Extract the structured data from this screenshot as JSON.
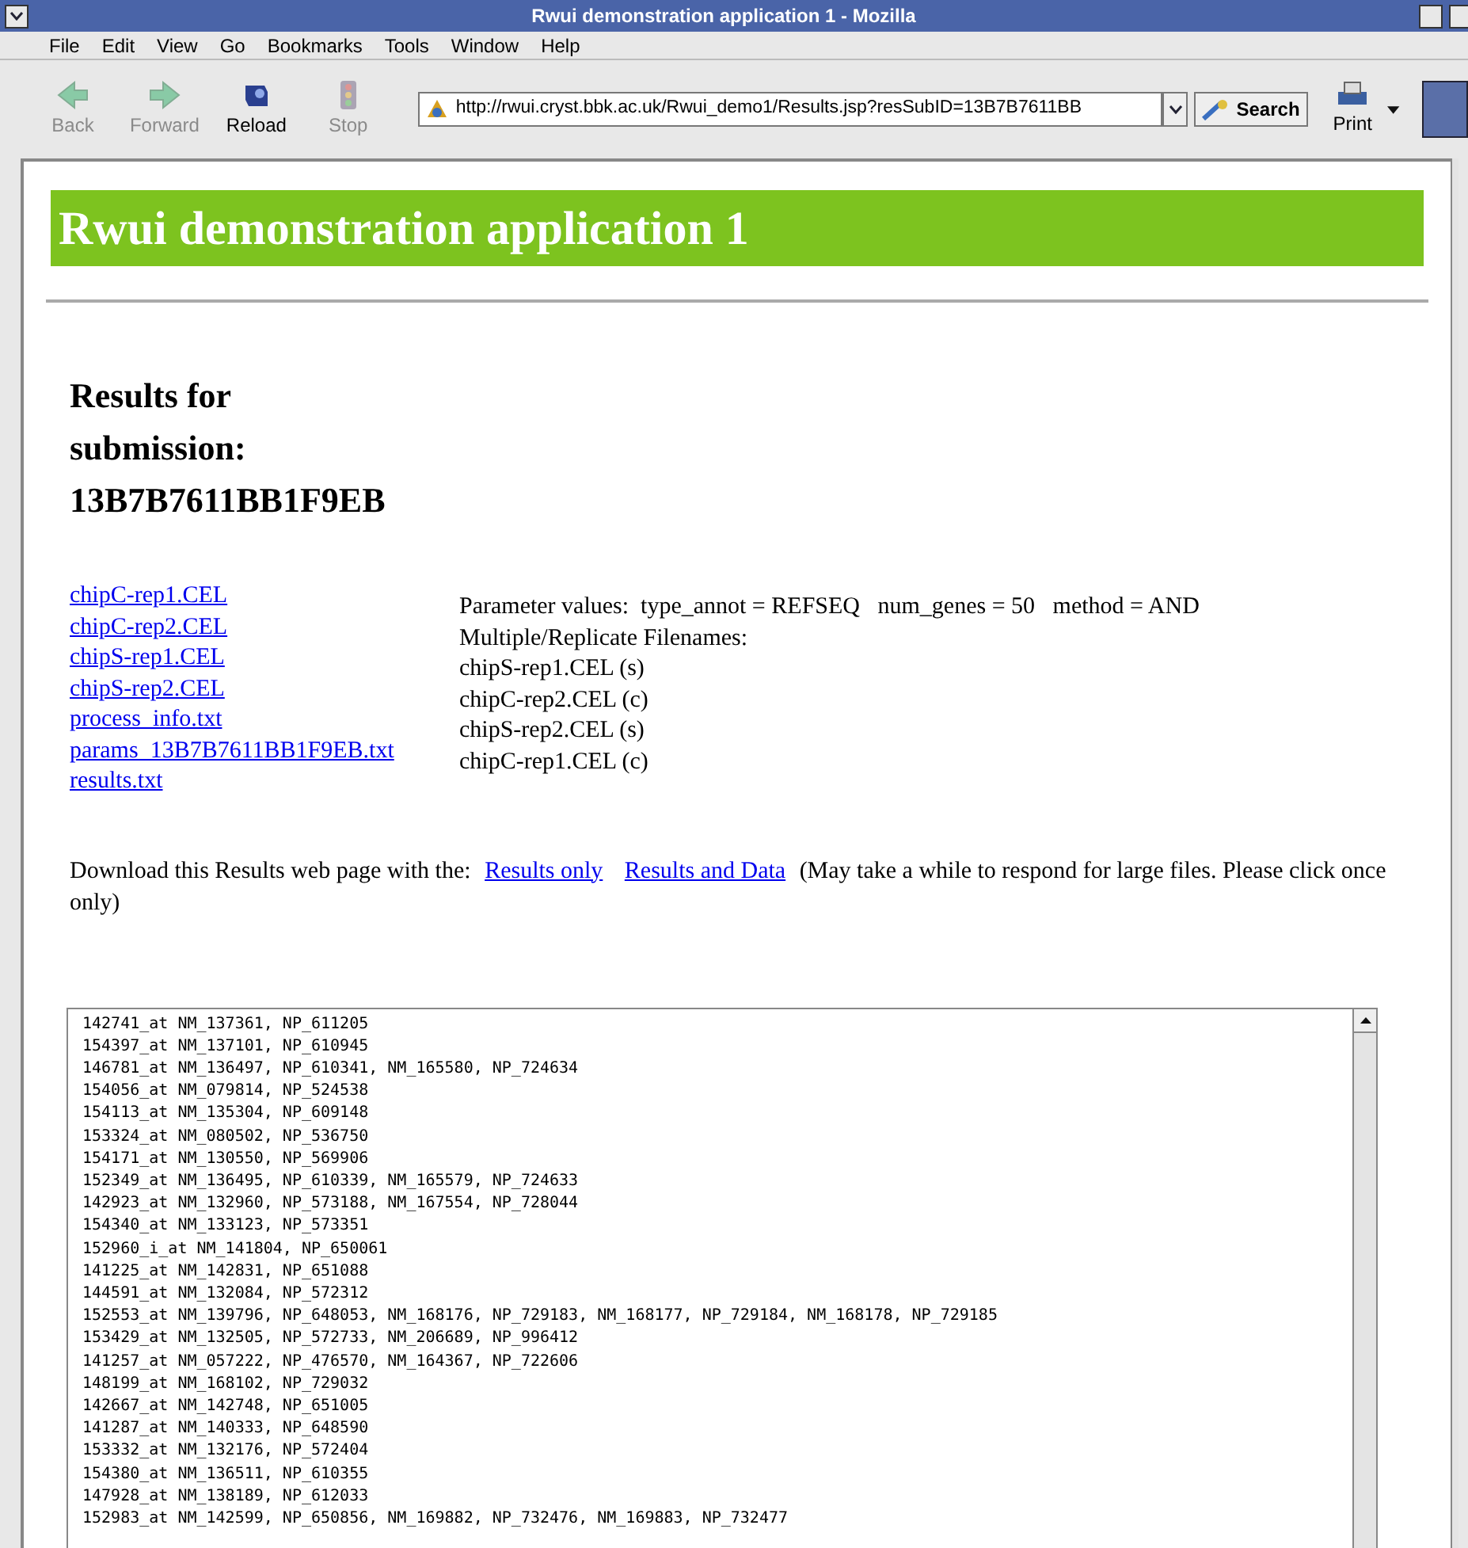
{
  "window": {
    "title": "Rwui demonstration application 1 - Mozilla"
  },
  "menu": [
    "File",
    "Edit",
    "View",
    "Go",
    "Bookmarks",
    "Tools",
    "Window",
    "Help"
  ],
  "toolbar": {
    "buttons": [
      {
        "label": "Back",
        "disabled": true,
        "kind": "back"
      },
      {
        "label": "Forward",
        "disabled": true,
        "kind": "forward"
      },
      {
        "label": "Reload",
        "disabled": false,
        "kind": "reload"
      },
      {
        "label": "Stop",
        "disabled": true,
        "kind": "stop"
      }
    ],
    "url": "http://rwui.cryst.bbk.ac.uk/Rwui_demo1/Results.jsp?resSubID=13B7B7611BB",
    "search": "Search",
    "print": "Print"
  },
  "page": {
    "header": "Rwui demonstration application 1",
    "heading": "Results for submission: 13B7B7611BB1F9EB",
    "files": [
      "chipC-rep1.CEL",
      "chipC-rep2.CEL",
      "chipS-rep1.CEL",
      "chipS-rep2.CEL",
      "process_info.txt",
      "params_13B7B7611BB1F9EB.txt",
      "results.txt"
    ],
    "parameters": "Parameter values:  type_annot = REFSEQ   num_genes = 50   method = AND",
    "replicate_heading": "Multiple/Replicate Filenames:",
    "replicates": [
      "chipS-rep1.CEL (s)",
      "chipC-rep2.CEL (c)",
      "chipS-rep2.CEL (s)",
      "chipC-rep1.CEL (c)"
    ],
    "download_text": "Download this Results web page with the:",
    "download_links": [
      "Results only",
      "Results and Data"
    ],
    "download_note": "(May take a while to respond for large files. Please click once only)",
    "results": [
      "142741_at NM_137361, NP_611205",
      "154397_at NM_137101, NP_610945",
      "146781_at NM_136497, NP_610341, NM_165580, NP_724634",
      "154056_at NM_079814, NP_524538",
      "154113_at NM_135304, NP_609148",
      "153324_at NM_080502, NP_536750",
      "154171_at NM_130550, NP_569906",
      "152349_at NM_136495, NP_610339, NM_165579, NP_724633",
      "142923_at NM_132960, NP_573188, NM_167554, NP_728044",
      "154340_at NM_133123, NP_573351",
      "152960_i_at NM_141804, NP_650061",
      "141225_at NM_142831, NP_651088",
      "144591_at NM_132084, NP_572312",
      "152553_at NM_139796, NP_648053, NM_168176, NP_729183, NM_168177, NP_729184, NM_168178, NP_729185",
      "153429_at NM_132505, NP_572733, NM_206689, NP_996412",
      "141257_at NM_057222, NP_476570, NM_164367, NP_722606",
      "148199_at NM_168102, NP_729032",
      "142667_at NM_142748, NP_651005",
      "141287_at NM_140333, NP_648590",
      "153332_at NM_132176, NP_572404",
      "154380_at NM_136511, NP_610355",
      "147928_at NM_138189, NP_612033",
      "152983_at NM_142599, NP_650856, NM_169882, NP_732476, NM_169883, NP_732477"
    ]
  }
}
